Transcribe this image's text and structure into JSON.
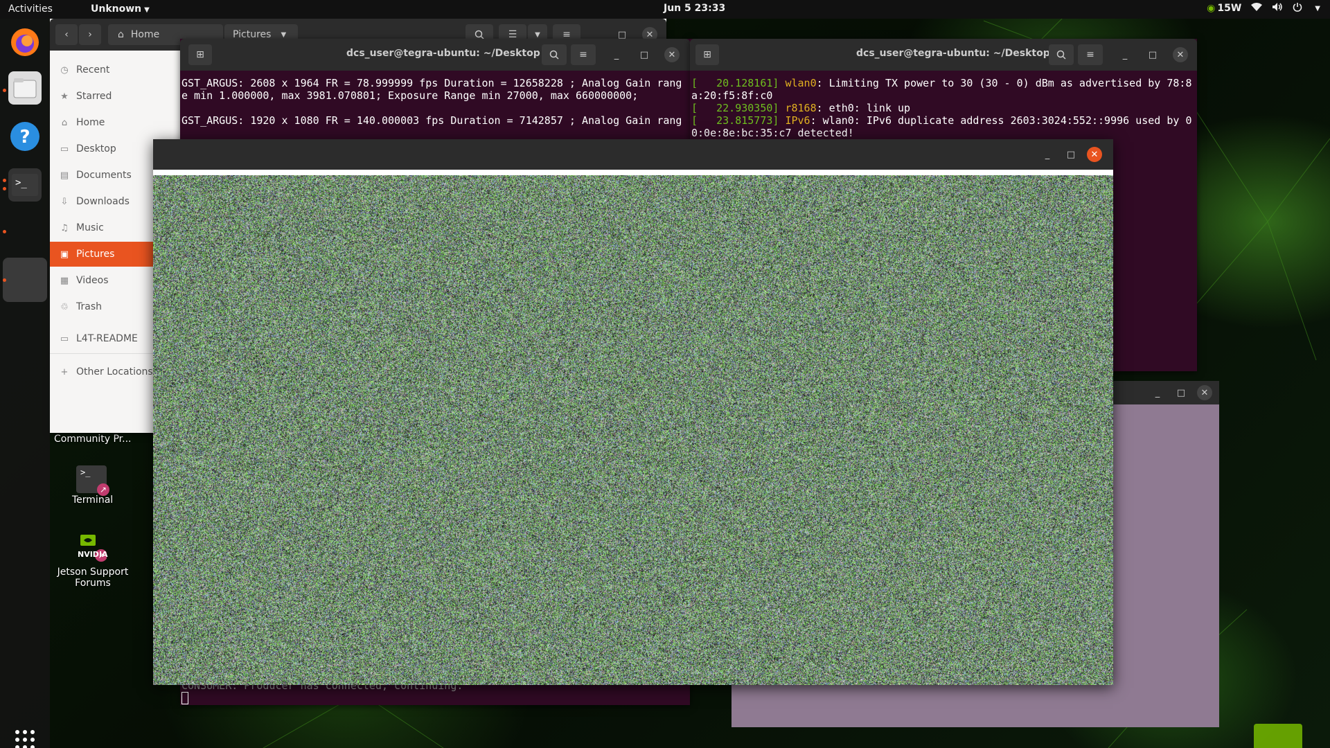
{
  "topbar": {
    "activities": "Activities",
    "app_menu": "Unknown",
    "clock": "Jun 5  23:33",
    "power": "15W"
  },
  "files": {
    "back_label": "‹",
    "forward_label": "›",
    "path_home": "Home",
    "path_current": "Pictures",
    "sidebar": [
      {
        "label": "Recent",
        "icon": "clock-icon",
        "glyph": "◷"
      },
      {
        "label": "Starred",
        "icon": "star-icon",
        "glyph": "★"
      },
      {
        "label": "Home",
        "icon": "home-icon",
        "glyph": "⌂"
      },
      {
        "label": "Desktop",
        "icon": "desktop-icon",
        "glyph": "▭"
      },
      {
        "label": "Documents",
        "icon": "document-icon",
        "glyph": "▤"
      },
      {
        "label": "Downloads",
        "icon": "download-icon",
        "glyph": "⇩"
      },
      {
        "label": "Music",
        "icon": "music-icon",
        "glyph": "♫"
      },
      {
        "label": "Pictures",
        "icon": "picture-icon",
        "glyph": "▣",
        "active": true
      },
      {
        "label": "Videos",
        "icon": "video-icon",
        "glyph": "▦"
      },
      {
        "label": "Trash",
        "icon": "trash-icon",
        "glyph": "♲"
      },
      {
        "label": "L4T-README",
        "icon": "drive-icon",
        "glyph": "▭"
      },
      {
        "label": "Other Locations",
        "icon": "plus-icon",
        "glyph": "+"
      }
    ]
  },
  "terminal_left": {
    "title": "dcs_user@tegra-ubuntu: ~/Desktop",
    "lines": [
      "GST_ARGUS: 2608 x 1964 FR = 78.999999 fps Duration = 12658228 ; Analog Gain rang",
      "e min 1.000000, max 3981.070801; Exposure Range min 27000, max 660000000;",
      "",
      "GST_ARGUS: 1920 x 1080 FR = 140.000003 fps Duration = 7142857 ; Analog Gain rang"
    ],
    "bottom_line": "CONSUMER: Producer has connected; continuing."
  },
  "terminal_right": {
    "title": "dcs_user@tegra-ubuntu: ~/Desktop",
    "lines": [
      {
        "ts": "[   20.128161]",
        "dev": "wlan0",
        "msg": ": Limiting TX power to 30 (30 - 0) dBm as advertised by 78:8"
      },
      {
        "ts": "",
        "dev": "",
        "msg": "a:20:f5:8f:c0"
      },
      {
        "ts": "[   22.930350]",
        "dev": "r8168",
        "msg": ": eth0: link up"
      },
      {
        "ts": "[   23.815773]",
        "dev": "IPv6",
        "msg": ": wlan0: IPv6 duplicate address 2603:3024:552::9996 used by 0"
      },
      {
        "ts": "",
        "dev": "",
        "msg": "0:0e:8e:bc:35:c7 detected!"
      }
    ]
  },
  "desktop": {
    "community_label": "Community Pr...",
    "terminal_label": "Terminal",
    "jetson_label_1": "Jetson Support",
    "jetson_label_2": "Forums",
    "nvidia_text": "NVIDIA"
  },
  "colors": {
    "accent": "#e95420",
    "terminal_bg": "#300a24",
    "header_bg": "#2c2c2c"
  }
}
